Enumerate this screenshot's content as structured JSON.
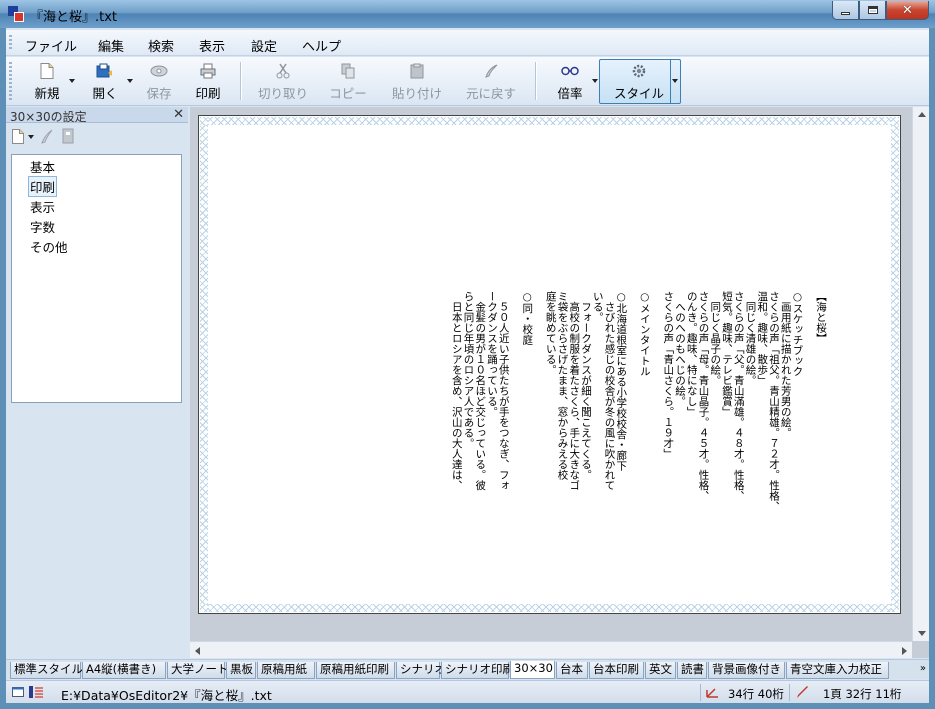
{
  "window": {
    "title": "『海と桜』.txt"
  },
  "menu": [
    "ファイル",
    "編集",
    "検索",
    "表示",
    "設定",
    "ヘルプ"
  ],
  "toolbar": {
    "new": "新規",
    "open": "開く",
    "save": "保存",
    "print": "印刷",
    "cut": "切り取り",
    "copy": "コピー",
    "paste": "貼り付け",
    "undo": "元に戻す",
    "zoom": "倍率",
    "style": "スタイル"
  },
  "left_pane": {
    "title": "30×30の設定",
    "tree": [
      "基本",
      "印刷",
      "表示",
      "字数",
      "その他"
    ],
    "selected": "印刷"
  },
  "document": {
    "lines": [
      "【海と桜】",
      "",
      "○スケッチブック",
      "　画用紙に描かれた芳男の絵。",
      "さくらの声「祖父。青山精雄。７２才。性格、",
      "温和。趣味、散歩」",
      "　同じく清雄の絵。",
      "さくらの声「父。青山滿雄。４８才。性格、",
      "短気。趣味、テレビ鑑賞」",
      "　同じく晶子の絵。",
      "さくらの声「母。青山晶子。４５才。性格、",
      "のんき。趣味、特になし」",
      "　へのへのもへじの絵。",
      "さくらの声「青山さくら。１９才」",
      "",
      "○メインタイトル",
      "",
      "○北海道根室にある小学校校舎・廊下",
      "　さびれた感じの校舎が冬の風に吹かれて",
      "いる。",
      "　フォークダンスが細く聞こえてくる。",
      "　高校の制服を着たさくら、手に大きなゴ",
      "ミ袋をぶらさげたまま、窓からみえる校",
      "庭を眺めている。",
      "",
      "○同・校庭",
      "",
      "　５０人近い子供たちが手をつなぎ、フォ",
      "ークダンスを踊っている。",
      "　金髪の男が１０名ほど交じっている。彼",
      "らと同じ年頃のロシア人である。",
      "　日本とロシアを含め、沢山の大人達は、"
    ]
  },
  "tabs": [
    "標準スタイル",
    "A4縦(横書き)",
    "大学ノート",
    "黒板",
    "原稿用紙",
    "原稿用紙印刷",
    "シナリオ",
    "シナリオ印刷",
    "30×30",
    "台本",
    "台本印刷",
    "英文",
    "読書",
    "背景画像付き",
    "青空文庫入力校正"
  ],
  "active_tab": "30×30",
  "status": {
    "path": "E:¥Data¥OsEditor2¥『海と桜』.txt",
    "chars": "34行 40桁",
    "position": "1頁 32行 11桁"
  }
}
